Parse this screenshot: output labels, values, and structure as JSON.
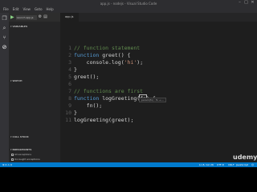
{
  "window": {
    "title": "app.js - nodejs - Visual Studio Code",
    "minimize": "–",
    "maximize": "□",
    "close": "✕"
  },
  "menu": {
    "items": [
      "File",
      "Edit",
      "View",
      "Goto",
      "Help"
    ]
  },
  "activity": {
    "icons": [
      "files-icon",
      "search-icon",
      "git-icon",
      "debug-icon",
      "extensions-icon"
    ]
  },
  "debug": {
    "play_glyph": "▶",
    "config": "Launch app.js",
    "gear_glyph": "⚙",
    "console_glyph": "▤"
  },
  "sidebar": {
    "variables": "VARIABLES",
    "watch": "WATCH",
    "call_stack": "CALL STACK",
    "breakpoints": "BREAKPOINTS",
    "breakpoint_items": [
      "All exceptions",
      "Uncaught exceptions"
    ]
  },
  "editor": {
    "tab": "app.js",
    "hint": "param(fn) : fn → ..."
  },
  "code": {
    "lines": [
      {
        "n": "1",
        "parts": [
          {
            "c": "cm",
            "t": "// function statement"
          }
        ]
      },
      {
        "n": "2",
        "parts": [
          {
            "c": "kw",
            "t": "function"
          },
          {
            "c": "",
            "t": " greet() {"
          }
        ]
      },
      {
        "n": "3",
        "parts": [
          {
            "c": "",
            "t": "    console.log("
          },
          {
            "c": "st",
            "t": "'hi'"
          },
          {
            "c": "",
            "t": ");"
          }
        ]
      },
      {
        "n": "4",
        "parts": [
          {
            "c": "",
            "t": "}"
          }
        ]
      },
      {
        "n": "5",
        "parts": [
          {
            "c": "",
            "t": "greet();"
          }
        ]
      },
      {
        "n": "6",
        "parts": [
          {
            "c": "",
            "t": ""
          }
        ]
      },
      {
        "n": "7",
        "parts": [
          {
            "c": "cm",
            "t": "// functions are first"
          }
        ]
      },
      {
        "n": "8",
        "parts": [
          {
            "c": "kw",
            "t": "function"
          },
          {
            "c": "",
            "t": " logGreeting("
          },
          {
            "c": "cursor-box",
            "t": "fn"
          },
          {
            "c": "",
            "t": ") {"
          }
        ]
      },
      {
        "n": "9",
        "parts": [
          {
            "c": "",
            "t": "    fn();"
          }
        ]
      },
      {
        "n": "10",
        "parts": [
          {
            "c": "",
            "t": "}"
          }
        ]
      },
      {
        "n": "11",
        "parts": [
          {
            "c": "",
            "t": "logGreeting(greet);"
          }
        ]
      }
    ]
  },
  "status": {
    "left": "⊗ 0  ⚠ 0",
    "position": "Ln 8, Col 26",
    "encoding": "UTF-8",
    "eol": "CRLF",
    "language": "JavaScript",
    "smiley": "☺"
  },
  "branding": {
    "logo": "udemy"
  }
}
